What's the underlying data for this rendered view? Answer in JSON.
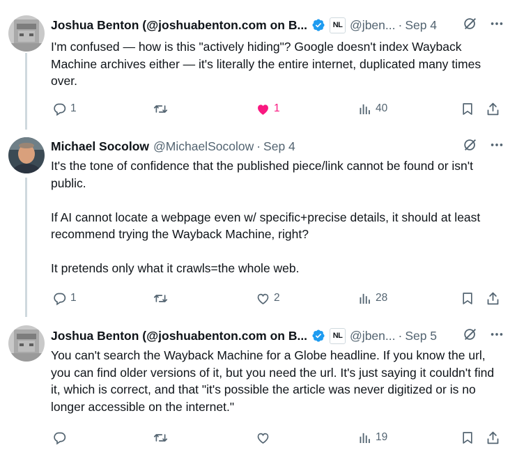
{
  "colors": {
    "text": "#0f1419",
    "secondary": "#536471",
    "verified": "#1d9bf0",
    "like": "#f91880",
    "thread_line": "#cfd9de"
  },
  "tweets": [
    {
      "name": "Joshua Benton (@joshuabenton.com on B...",
      "verified": true,
      "affiliate_badge": "NL",
      "handle": "@jben...",
      "sep": "·",
      "date": "Sep 4",
      "text": "I'm confused — how is this \"actively hiding\"? Google doesn't index Wayback Machine archives either — it's literally the entire internet, duplicated many times over.",
      "replies": "1",
      "retweets": "",
      "likes": "1",
      "liked": true,
      "views": "40"
    },
    {
      "name": "Michael Socolow",
      "verified": false,
      "handle": "@MichaelSocolow",
      "sep": "·",
      "date": "Sep 4",
      "text": "It's the tone of confidence that the published piece/link cannot be found or isn't public.\n\nIf AI cannot locate a webpage even w/ specific+precise details, it should at least recommend trying the Wayback Machine, right?\n\nIt pretends only what it crawls=the whole web.",
      "replies": "1",
      "retweets": "",
      "likes": "2",
      "liked": false,
      "views": "28"
    },
    {
      "name": "Joshua Benton (@joshuabenton.com on B...",
      "verified": true,
      "affiliate_badge": "NL",
      "handle": "@jben...",
      "sep": "·",
      "date": "Sep 5",
      "text": "You can't search the Wayback Machine for a Globe headline. If you know the url, you can find older versions of it, but you need the url. It's just saying it couldn't find it, which is correct, and that \"it's possible the article was never digitized or is no longer accessible on the internet.\"",
      "replies": "",
      "retweets": "",
      "likes": "",
      "liked": false,
      "views": "19"
    }
  ],
  "icons": {
    "grok": "grok-icon",
    "more": "more-icon",
    "reply": "reply-icon",
    "retweet": "retweet-icon",
    "like": "heart-icon",
    "views": "views-icon",
    "bookmark": "bookmark-icon",
    "share": "share-icon"
  }
}
